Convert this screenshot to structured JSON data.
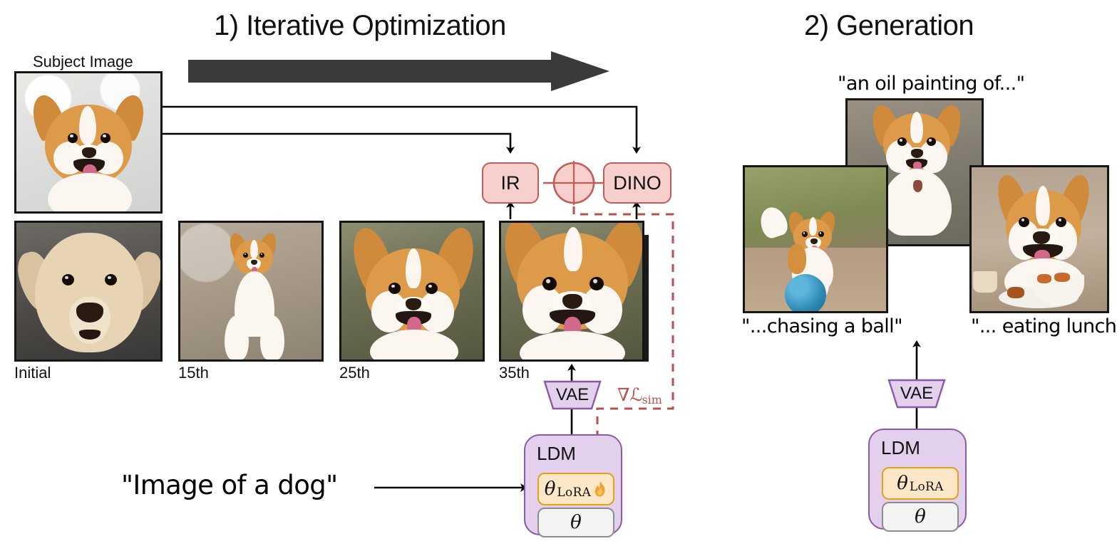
{
  "sections": {
    "left_title": "1) Iterative Optimization",
    "right_title": "2) Generation"
  },
  "left_panel": {
    "subject_label": "Subject Image",
    "iterations": [
      {
        "label": "Initial",
        "scene": "studio-cream-dog"
      },
      {
        "label": "15th",
        "scene": "park-sitting-dog"
      },
      {
        "label": "25th",
        "scene": "closeup-corgi"
      },
      {
        "label": "35th",
        "scene": "closeup-corgi-final"
      }
    ],
    "encoders": {
      "ir_label": "IR",
      "dino_label": "DINO",
      "combine_icon": "circle-plus-icon"
    },
    "vae_label": "VAE",
    "ldm_label": "LDM",
    "lora_label": "θ",
    "lora_sub": "LoRA",
    "lora_icon": "flame-icon",
    "theta_label": "θ",
    "gradient_label": "∇ℒ",
    "gradient_sub": "sim",
    "prompt": "\"Image of a dog\""
  },
  "right_panel": {
    "top_caption": "\"an oil painting of...\"",
    "left_caption": "\"...chasing a ball\"",
    "right_caption": "\"... eating lunch\"",
    "vae_label": "VAE",
    "ldm_label": "LDM",
    "lora_label": "θ",
    "lora_sub": "LoRA",
    "theta_label": "θ"
  },
  "colors": {
    "pink_fill": "#f7cfcc",
    "pink_border": "#bf5d56",
    "purple_fill": "#e3d0ec",
    "purple_border": "#8a5aa6",
    "orange_fill": "#fde7c6",
    "orange_border": "#e4a11e",
    "gray_fill": "#f3f3f3",
    "gray_border": "#8d8d8d",
    "gradient_red": "#b5524c",
    "arrow_dark": "#3a3a3a"
  }
}
